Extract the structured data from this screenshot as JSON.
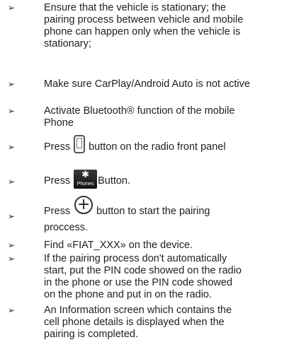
{
  "bullet_glyph": "➢",
  "items": [
    {
      "lines": [
        "Ensure that the vehicle is stationary; the",
        "pairing process between vehicle and mobile",
        "phone can happen only when the vehicle is",
        "stationary;"
      ]
    },
    {
      "lines": [
        "Make sure CarPlay/Android Auto is not  active"
      ]
    },
    {
      "lines": [
        "Activate Bluetooth® function of  the  mobile",
        "Phone"
      ]
    },
    {
      "before": "Press",
      "after": "button on the radio front  panel",
      "icon": "phone-button-icon"
    },
    {
      "before": "Press",
      "after": "Button.",
      "icon": "bluetooth-phones-icon",
      "icon_label": "Phones"
    },
    {
      "before": "Press",
      "after": "button to start the pairing",
      "line2": "proccess.",
      "icon": "plus-circle-icon"
    },
    {
      "lines": [
        "Find «FIAT_XXX» on the device."
      ]
    },
    {
      "lines": [
        "If the pairing process don't automatically",
        "start, put the PIN code showed on the radio",
        "in the phone or use the PIN code showed",
        "on the phone and put in on the radio."
      ]
    },
    {
      "lines": [
        "An Information screen which contains  the",
        "cell phone details is displayed when  the",
        "pairing is completed."
      ]
    }
  ]
}
